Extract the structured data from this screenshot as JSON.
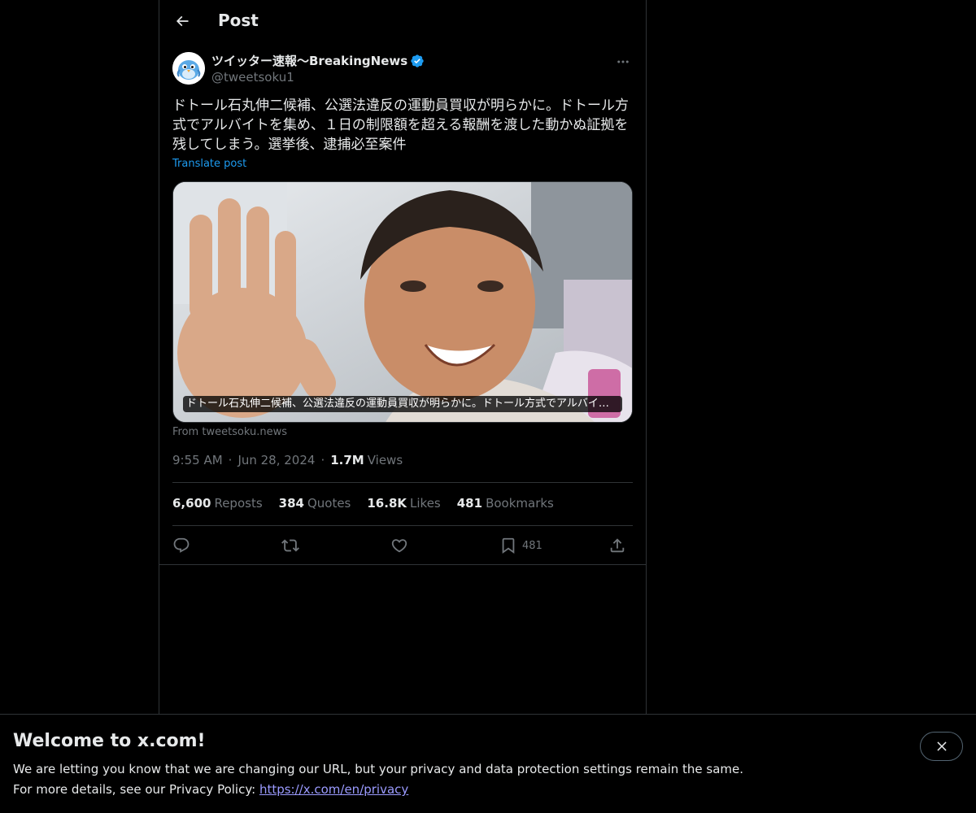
{
  "header": {
    "title": "Post",
    "back_icon": "back-arrow-icon"
  },
  "author": {
    "name": "ツイッター速報〜BreakingNews",
    "handle": "@tweetsoku1",
    "verified": true,
    "verified_color": "#1d9bf0"
  },
  "tweet": {
    "text": "ドトール石丸伸二候補、公選法違反の運動員買収が明らかに。ドトール方式でアルバイトを集め、１日の制限額を超える報酬を渡した動かぬ証拠を残してしまう。選挙後、逮捕必至案件",
    "translate_label": "Translate post"
  },
  "media": {
    "caption": "ドトール石丸伸二候補、公選法違反の運動員買収が明らかに。ドトール方式でアルバイト...",
    "source": "From tweetsoku.news"
  },
  "meta": {
    "time": "9:55 AM",
    "date": "Jun 28, 2024",
    "views_count": "1.7M",
    "views_label": "Views"
  },
  "stats": {
    "reposts": {
      "count": "6,600",
      "label": "Reposts"
    },
    "quotes": {
      "count": "384",
      "label": "Quotes"
    },
    "likes": {
      "count": "16.8K",
      "label": "Likes"
    },
    "bookmarks": {
      "count": "481",
      "label": "Bookmarks"
    }
  },
  "actions": {
    "bookmark_count": "481"
  },
  "banner": {
    "title": "Welcome to x.com!",
    "line1": "We are letting you know that we are changing our URL, but your privacy and data protection settings remain the same.",
    "line2_prefix": "For more details, see our Privacy Policy: ",
    "link_text": "https://x.com/en/privacy"
  },
  "colors": {
    "background": "#000000",
    "text_primary": "#e7e9ea",
    "text_secondary": "#71767b",
    "accent": "#1d9bf0",
    "border": "#2f3336"
  }
}
